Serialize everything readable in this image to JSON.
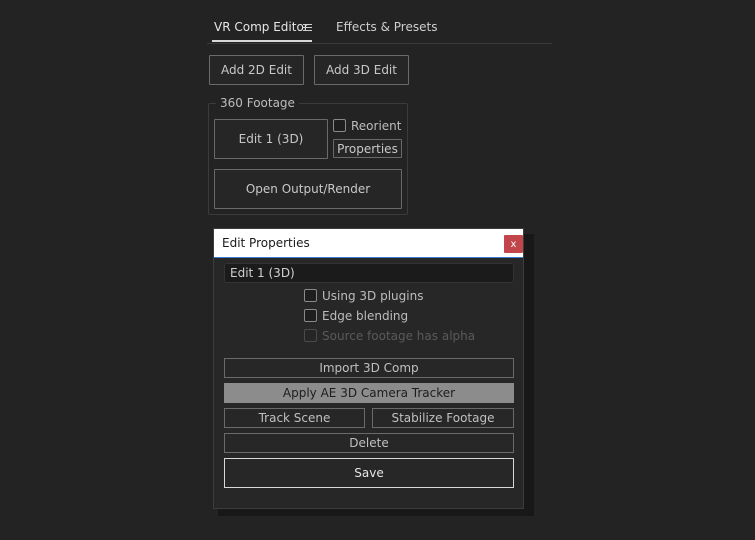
{
  "tabs": [
    {
      "label": "VR Comp Editor",
      "active": true
    },
    {
      "label": "Effects & Presets",
      "active": false
    }
  ],
  "menu_icon": "hamburger-menu-icon",
  "toolbar": {
    "add_2d_label": "Add 2D Edit",
    "add_3d_label": "Add 3D Edit"
  },
  "footage_group": {
    "title": "360 Footage",
    "edit_button_label": "Edit 1 (3D)",
    "reorient_label": "Reorient",
    "reorient_checked": false,
    "properties_label": "Properties",
    "open_output_label": "Open Output/Render"
  },
  "dialog": {
    "title": "Edit Properties",
    "close_label": "x",
    "name_value": "Edit 1 (3D)",
    "options": [
      {
        "label": "Using 3D plugins",
        "checked": false,
        "enabled": true
      },
      {
        "label": "Edge blending",
        "checked": false,
        "enabled": true
      },
      {
        "label": "Source footage has alpha",
        "checked": false,
        "enabled": false
      }
    ],
    "import_label": "Import 3D Comp",
    "apply_tracker_label": "Apply AE 3D Camera Tracker",
    "track_scene_label": "Track Scene",
    "stabilize_label": "Stabilize Footage",
    "delete_label": "Delete",
    "save_label": "Save"
  },
  "colors": {
    "background": "#232323",
    "dialog_bg": "#272727",
    "close_button": "#c2454b",
    "highlight_button": "#8c8c8c"
  }
}
